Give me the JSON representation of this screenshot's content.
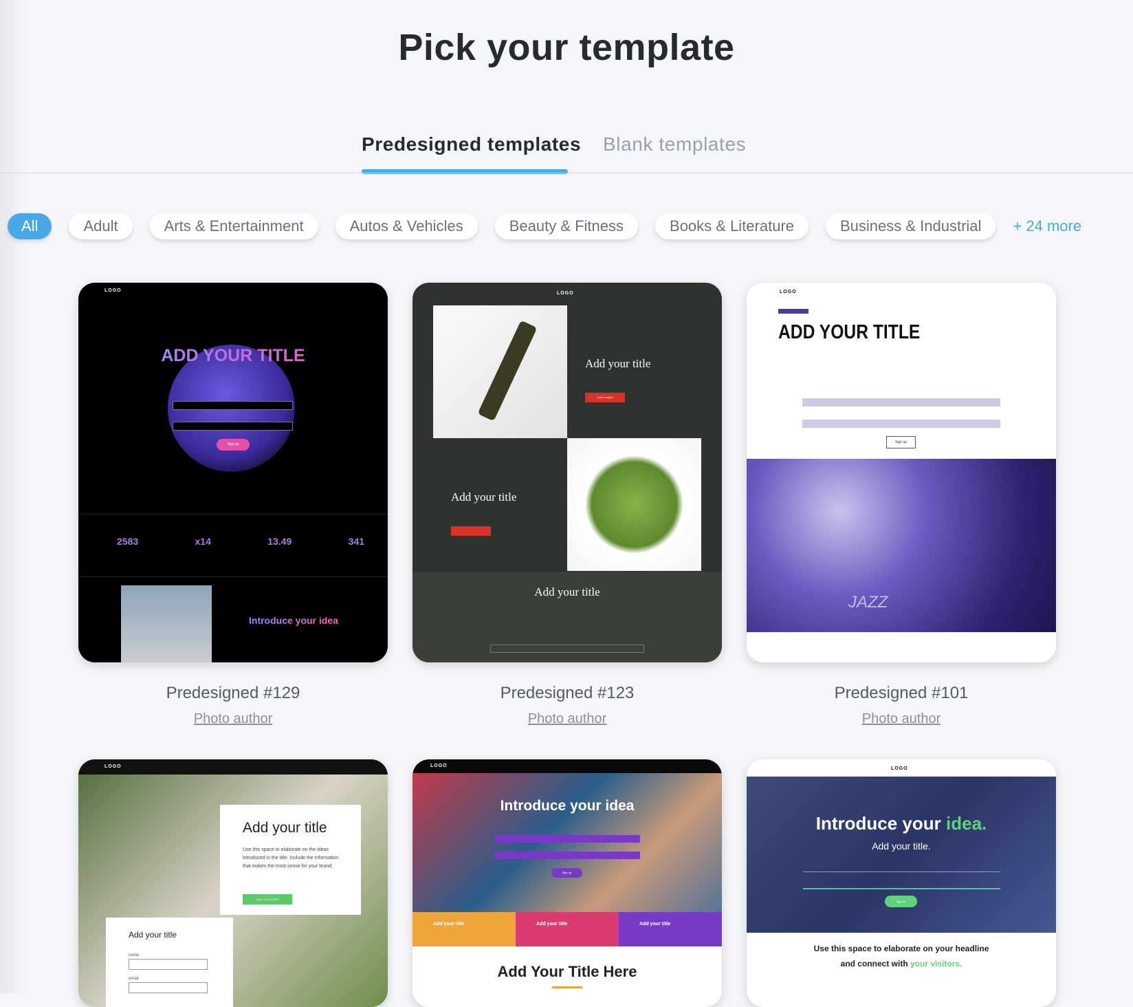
{
  "page_title": "Pick your template",
  "tabs": [
    {
      "label": "Predesigned templates",
      "active": true
    },
    {
      "label": "Blank templates",
      "active": false
    }
  ],
  "accent": "#4aa8e8",
  "categories": [
    {
      "label": "All",
      "active": true
    },
    {
      "label": "Adult"
    },
    {
      "label": "Arts & Entertainment"
    },
    {
      "label": "Autos & Vehicles"
    },
    {
      "label": "Beauty & Fitness"
    },
    {
      "label": "Books & Literature"
    },
    {
      "label": "Business & Industrial"
    }
  ],
  "more_label": "+ 24 more",
  "templates": [
    {
      "name": "Predesigned #129",
      "author": "Photo author",
      "preview": {
        "logo": "LOGO",
        "title": "ADD YOUR TITLE",
        "button": "Sign up",
        "stats": [
          "2583",
          "x14",
          "13.49",
          "341"
        ],
        "section": "Introduce your idea"
      }
    },
    {
      "name": "Predesigned #123",
      "author": "Photo author",
      "preview": {
        "logo": "LOGO",
        "title1": "Add your title",
        "title2": "Add your title",
        "title3": "Add your title",
        "button": "Call to action"
      }
    },
    {
      "name": "Predesigned #101",
      "author": "Photo author",
      "preview": {
        "logo": "LOGO",
        "title": "ADD YOUR TITLE",
        "button": "Sign up",
        "image_text": "JAZZ"
      }
    },
    {
      "name": "",
      "author": "",
      "preview": {
        "logo": "LOGO",
        "title": "Add your title",
        "body": "Use this space to elaborate on the ideas introduced in the title. Include the information that makes the most sense for your brand.",
        "button": "CALL TO ACTION",
        "form_title": "Add your title",
        "field1": "name",
        "field2": "email"
      }
    },
    {
      "name": "",
      "author": "",
      "preview": {
        "logo": "LOGO",
        "title": "Introduce your idea",
        "button": "Sign up",
        "boxes": [
          "Add your title",
          "Add your title",
          "Add your title"
        ],
        "heading": "Add Your Title Here"
      }
    },
    {
      "name": "",
      "author": "",
      "preview": {
        "logo": "LOGO",
        "title": "Introduce your",
        "title_accent": "idea.",
        "subtitle": "Add your title.",
        "button": "Sign up",
        "body": "Use this space to elaborate on your headline",
        "body2": "and connect with",
        "body2_accent": "your visitors."
      }
    }
  ]
}
